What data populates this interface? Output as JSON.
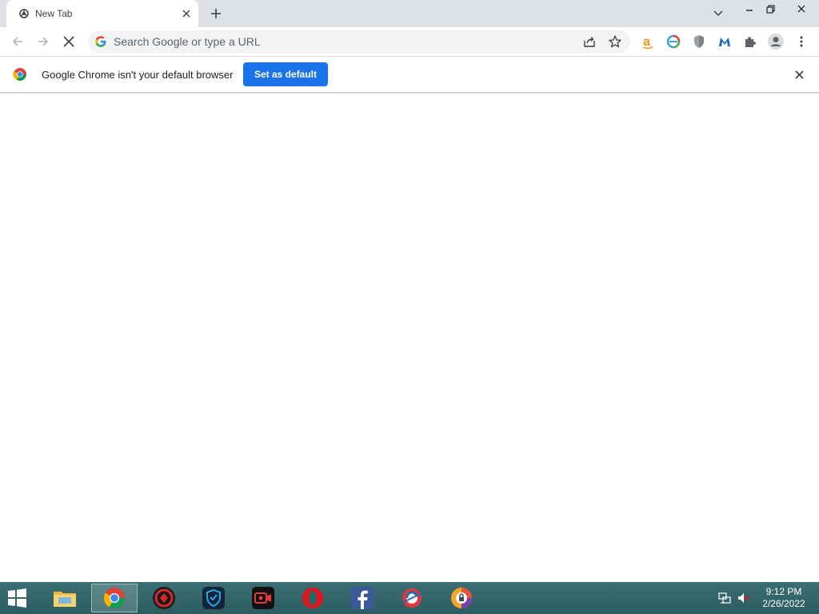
{
  "browser": {
    "tab": {
      "title": "New Tab",
      "favicon": "chrome-newtab-icon",
      "close_icon": "close-icon"
    },
    "new_tab_icon": "plus-icon",
    "tab_search_icon": "chevron-down-icon",
    "window_controls": {
      "minimize": "minimize-icon",
      "restore": "restore-icon",
      "close": "close-icon"
    },
    "toolbar": {
      "back_icon": "arrow-left-icon",
      "forward_icon": "arrow-right-icon",
      "stop_icon": "close-icon",
      "omnibox": {
        "placeholder": "Search Google or type a URL",
        "value": "",
        "share_icon": "share-icon",
        "bookmark_icon": "star-icon"
      },
      "extensions": [
        "amazon-icon",
        "edge-e-icon",
        "shield-icon",
        "malwarebytes-icon",
        "puzzle-icon"
      ],
      "profile_icon": "person-icon",
      "menu_icon": "kebab-menu-icon"
    },
    "infobar": {
      "message": "Google Chrome isn't your default browser",
      "button_label": "Set as default",
      "close_icon": "close-icon"
    },
    "colors": {
      "accent": "#1a73e8",
      "tabstrip": "#dee1e6",
      "omnibox": "#f1f3f4"
    }
  },
  "taskbar": {
    "start_icon": "windows-icon",
    "items": [
      {
        "name": "file-explorer-icon",
        "active": false
      },
      {
        "name": "chrome-icon",
        "active": true
      },
      {
        "name": "antivirus-icon",
        "active": false
      },
      {
        "name": "vpn-shield-icon",
        "active": false
      },
      {
        "name": "screen-recorder-icon",
        "active": false
      },
      {
        "name": "opera-icon",
        "active": false
      },
      {
        "name": "facebook-icon",
        "active": false
      },
      {
        "name": "ccleaner-icon",
        "active": false
      },
      {
        "name": "lock-app-icon",
        "active": false
      }
    ],
    "tray": {
      "network_icon": "network-icon",
      "volume_icon": "volume-muted-icon"
    },
    "clock": {
      "time": "9:12 PM",
      "date": "2/26/2022"
    },
    "colors": {
      "background": "#2f6266"
    }
  }
}
